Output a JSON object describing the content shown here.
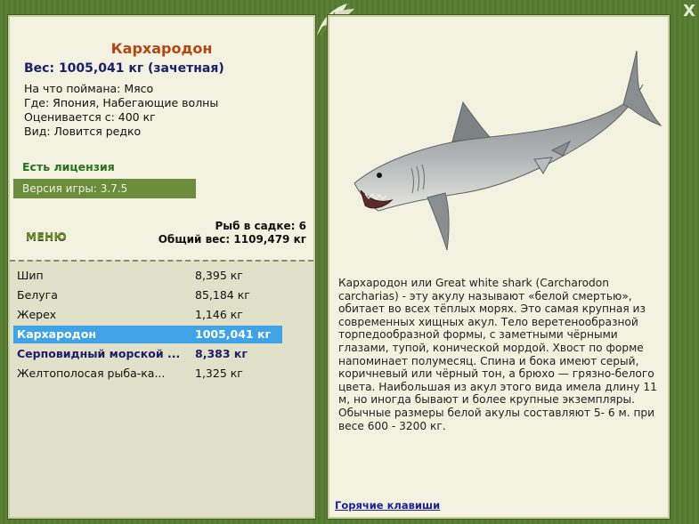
{
  "fish": {
    "name": "Кархародон",
    "weight_line": "Вес: 1005,041 кг (зачетная)",
    "caught_on": "На что поймана: Мясо",
    "location": "Где: Япония, Набегающие волны",
    "valued_from": "Оценивается с: 400 кг",
    "rarity": "Вид: Ловится редко",
    "license": "Есть лицензия",
    "description": "Кархародон или Great white shark (Carcharodon carcharias) - эту акулу называют «белой смертью», обитает во всех тёплых морях. Это самая крупная из современных хищных акул. Тело веретенообразной торпедообразной формы, с заметными чёрными глазами, тупой, конической мордой. Хвост по форме напоминает полумесяц. Спина и бока имеют серый, коричневый или чёрный тон, а брюхо — грязно-белого цвета. Наибольшая из акул этого вида имела длину 11 м, но иногда бывают и более крупные экземпляры. Обычные размеры белой акулы составляют 5- 6 м. при весе 600 - 3200 кг."
  },
  "version": "Версия игры: 3.7.5",
  "menu_label": "МЕНЮ",
  "keepnet": {
    "count": "Рыб в садке: 6",
    "total": "Общий вес: 1109,479 кг"
  },
  "catch_list": [
    {
      "name": "Шип",
      "weight": "8,395 кг"
    },
    {
      "name": "Белуга",
      "weight": "85,184 кг"
    },
    {
      "name": "Жерех",
      "weight": "1,146 кг"
    },
    {
      "name": "Кархародон",
      "weight": "1005,041 кг"
    },
    {
      "name": "Серповидный морской ...",
      "weight": "8,383 кг"
    },
    {
      "name": "Желтополосая рыба-ка...",
      "weight": "1,325 кг"
    }
  ],
  "hotkeys_link": "Горячие клавиши",
  "close_label": "X",
  "icons": {
    "close": "close-icon",
    "leaf": "leaf-decoration-icon",
    "shark": "shark-image"
  }
}
